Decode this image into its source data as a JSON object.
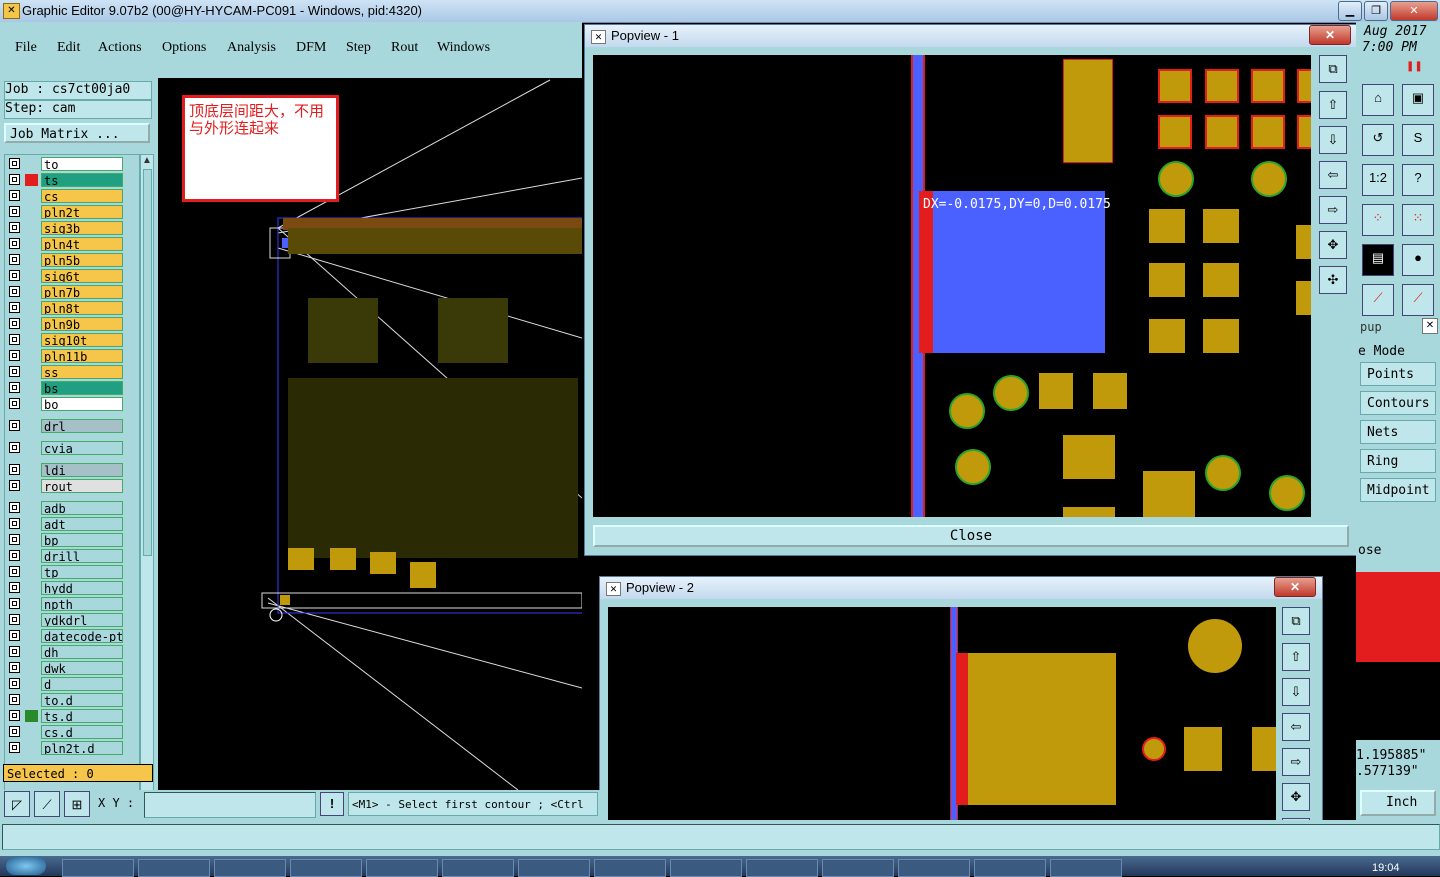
{
  "window": {
    "title": "Graphic Editor 9.07b2 (00@HY-HYCAM-PC091 - Windows, pid:4320)",
    "min": "▁",
    "max": "❐",
    "close": "✕"
  },
  "menu": [
    "File",
    "Edit",
    "Actions",
    "Options",
    "Analysis",
    "DFM",
    "Step",
    "Rout",
    "Windows"
  ],
  "job": {
    "label": "Job : cs7ct00ja0",
    "step": "Step: cam",
    "matrix_button": "Job Matrix ..."
  },
  "layers": [
    {
      "name": "to",
      "color": "#ffffff"
    },
    {
      "name": "ts",
      "color": "#20a080",
      "marker": "#e31d1d"
    },
    {
      "name": "cs",
      "color": "#f5c64a"
    },
    {
      "name": "pln2t",
      "color": "#f5c64a"
    },
    {
      "name": "sig3b",
      "color": "#f5c64a"
    },
    {
      "name": "pln4t",
      "color": "#f5c64a"
    },
    {
      "name": "pln5b",
      "color": "#f5c64a"
    },
    {
      "name": "sig6t",
      "color": "#f5c64a"
    },
    {
      "name": "pln7b",
      "color": "#f5c64a"
    },
    {
      "name": "pln8t",
      "color": "#f5c64a"
    },
    {
      "name": "pln9b",
      "color": "#f5c64a"
    },
    {
      "name": "sig10t",
      "color": "#f5c64a"
    },
    {
      "name": "pln11b",
      "color": "#f5c64a"
    },
    {
      "name": "ss",
      "color": "#f5c64a"
    },
    {
      "name": "bs",
      "color": "#20a080"
    },
    {
      "name": "bo",
      "color": "#ffffff"
    },
    {
      "name": "drl",
      "color": "#a6c0c8"
    },
    {
      "name": "cvia",
      "color": "#a8d8dc"
    },
    {
      "name": "ldi",
      "color": "#a6c0c8"
    },
    {
      "name": "rout",
      "color": "#e0e0e0"
    },
    {
      "name": "adb",
      "color": "#a8d8dc"
    },
    {
      "name": "adt",
      "color": "#a8d8dc"
    },
    {
      "name": "bp",
      "color": "#a8d8dc"
    },
    {
      "name": "drill",
      "color": "#a8d8dc"
    },
    {
      "name": "tp",
      "color": "#a8d8dc"
    },
    {
      "name": "hydd",
      "color": "#a8d8dc"
    },
    {
      "name": "npth",
      "color": "#a8d8dc"
    },
    {
      "name": "ydkdrl",
      "color": "#a8d8dc"
    },
    {
      "name": "datecode-pt",
      "color": "#a8d8dc"
    },
    {
      "name": "dh",
      "color": "#a8d8dc"
    },
    {
      "name": "dwk",
      "color": "#a8d8dc"
    },
    {
      "name": "d",
      "color": "#a8d8dc"
    },
    {
      "name": "to.d",
      "color": "#a8d8dc"
    },
    {
      "name": "ts.d",
      "color": "#a8d8dc",
      "marker": "#2a8a2a"
    },
    {
      "name": "cs.d",
      "color": "#a8d8dc"
    },
    {
      "name": "pln2t.d",
      "color": "#a8d8dc"
    }
  ],
  "selected": "Selected : 0",
  "note": "顶底层间距大，不用与外形连起来",
  "xy_label": "X Y :",
  "xy_value": "",
  "exclaim": "!",
  "prompt": "<M1> - Select first contour ; <Ctrl",
  "clock": {
    "date": "Aug 2017",
    "time": "7:00 PM"
  },
  "popview1": {
    "title": "Popview - 1",
    "measure_text": "DX=-0.0175,DY=0,D=0.0175",
    "close_label": "Close"
  },
  "popview2": {
    "title": "Popview - 2"
  },
  "right_panel": {
    "group_label": "pup",
    "mode_label": "e Mode",
    "buttons": [
      "Points",
      "Contours",
      "Nets",
      "Ring",
      "Midpoint"
    ],
    "close_label": "ose",
    "coord_x": "1.195885\"",
    "coord_y": ".577139\"",
    "units": "Inch"
  },
  "taskbar": {
    "time": "19:04"
  }
}
